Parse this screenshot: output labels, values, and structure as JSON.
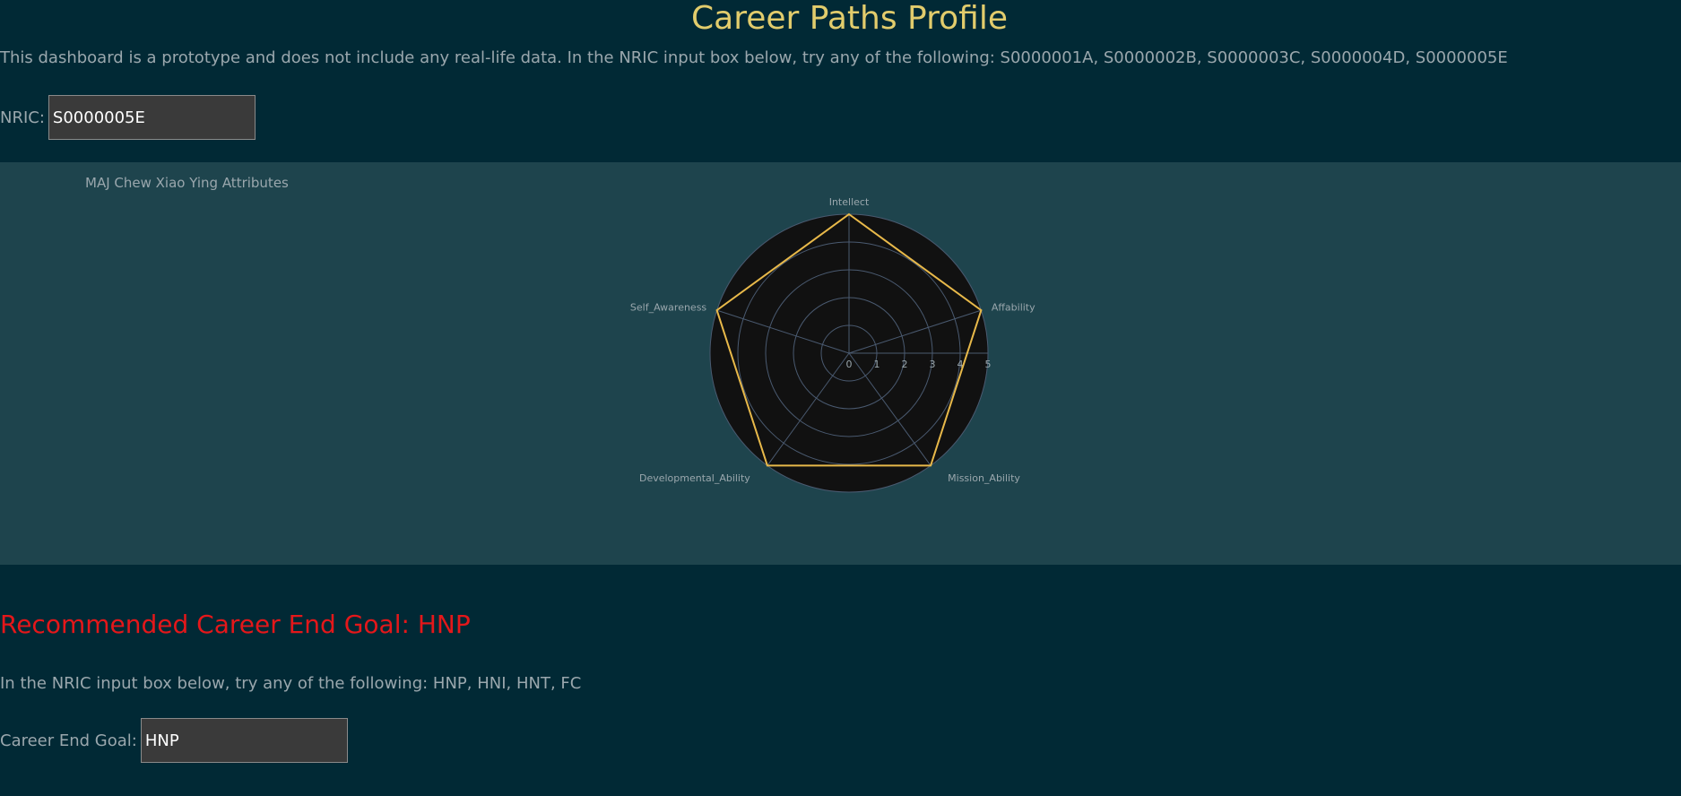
{
  "header": {
    "title": "Career Paths Profile",
    "intro": "This dashboard is a prototype and does not include any real-life data. In the NRIC input box below, try any of the following: S0000001A, S0000002B, S0000003C, S0000004D, S0000005E"
  },
  "nric": {
    "label": "NRIC:",
    "value": "S0000005E"
  },
  "chart_data": {
    "type": "radar",
    "title": "MAJ Chew Xiao Ying Attributes",
    "axes": [
      "Intellect",
      "Affability",
      "Mission_Ability",
      "Developmental_Ability",
      "Self_Awareness"
    ],
    "values": [
      5,
      5,
      5,
      5,
      5
    ],
    "radial_range": [
      0,
      5
    ],
    "radial_ticks": [
      "0",
      "1",
      "2",
      "3",
      "4",
      "5"
    ],
    "colors": {
      "line": "#e8b94a",
      "polar_bg": "#111111",
      "grid": "#4a5a70",
      "panel_bg": "#1e444d"
    }
  },
  "goal": {
    "heading": "Recommended Career End Goal: HNP",
    "hint": "In the NRIC input box below, try any of the following: HNP, HNI, HNT, FC",
    "label": "Career End Goal:",
    "value": "HNP"
  },
  "colors": {
    "page_bg": "#012935",
    "title": "#e2cc6c",
    "goal_heading": "#e4171a",
    "text": "#9aa7ad"
  }
}
